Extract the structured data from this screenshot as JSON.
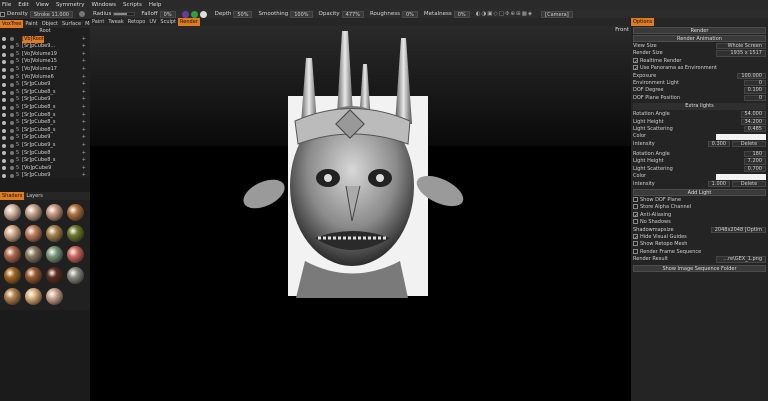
{
  "menubar": [
    "File",
    "Edit",
    "View",
    "Symmetry",
    "Windows",
    "Scripts",
    "Help"
  ],
  "toolbar": {
    "density_label": "Density",
    "density_value": "Stroke 11.000",
    "radius_label": "Radius",
    "radius_value": "65%",
    "falloff_label": "Falloff",
    "falloff_value": "0%",
    "depth_label": "Depth",
    "depth_value": "50%",
    "smoothing_label": "Smoothing",
    "smoothing_value": "100%",
    "opacity_label": "Opacity",
    "opacity_value": "477%",
    "roughness_label": "Roughness",
    "roughness_value": "0%",
    "metalness_label": "Metalness",
    "metalness_value": "0%",
    "camera_label": "[Camera]"
  },
  "left_tabs": [
    "VoxTree",
    "Paint",
    "Object",
    "Surface",
    "Mat"
  ],
  "tree": {
    "root": "Root",
    "items": [
      {
        "n": "",
        "label": "[Vb]Root",
        "sel": true
      },
      {
        "n": "5",
        "label": "[Sr]pCube9..."
      },
      {
        "n": "5",
        "label": "[Vo]Volume19"
      },
      {
        "n": "5",
        "label": "[Vo]Volume15"
      },
      {
        "n": "5",
        "label": "[Vo]Volume17"
      },
      {
        "n": "5",
        "label": "[Vo]Volume6"
      },
      {
        "n": "5",
        "label": "[Sr]pCube9"
      },
      {
        "n": "5",
        "label": "[Sr]pCube8_s"
      },
      {
        "n": "5",
        "label": "[Sr]pCube9"
      },
      {
        "n": "5",
        "label": "[Sr]pCube8_s"
      },
      {
        "n": "5",
        "label": "[Sr]pCube8_s"
      },
      {
        "n": "5",
        "label": "[Sr]pCube8_s"
      },
      {
        "n": "5",
        "label": "[Sr]pCube8_s"
      },
      {
        "n": "5",
        "label": "[Sr]pCube9"
      },
      {
        "n": "5",
        "label": "[Sr]pCube9_s"
      },
      {
        "n": "5",
        "label": "[Sr]pCube8"
      },
      {
        "n": "5",
        "label": "[Sr]pCube8_s"
      },
      {
        "n": "5",
        "label": "[Vo]pCube9"
      },
      {
        "n": "5",
        "label": "[Sr]pCube9"
      },
      {
        "n": "5",
        "label": "[Sr]pCube9"
      }
    ]
  },
  "shader_tabs": [
    "Shaders",
    "Layers"
  ],
  "shader_colors": [
    "#d8b7a0",
    "#c8a58c",
    "#c99a7e",
    "#b3723e",
    "#d4ac8c",
    "#c27f5c",
    "#a8844c",
    "#6f7a2c",
    "#b26a4a",
    "#8c7c5e",
    "#7b9a7b",
    "#d26a60",
    "#a06820",
    "#9a5a30",
    "#5a2e1c",
    "#8a8a80",
    "#b4824c",
    "#dcb07a",
    "#cba48a"
  ],
  "viewport_tabs": [
    "Paint",
    "Tweak",
    "Retopo",
    "UV",
    "Sculpt",
    "Render"
  ],
  "viewport_active": "Render",
  "viewport_label": "Front",
  "right_tabs": [
    "Options"
  ],
  "render": {
    "render_btn": "Render",
    "render_anim_btn": "Render Animation",
    "view_size_label": "View Size",
    "view_size_value": "Whole Screen",
    "render_size_label": "Render Size",
    "render_size_value": "1935 x 1517",
    "realtime_label": "Realtime Render",
    "panorama_label": "Use Panorama as Environment",
    "exposure_label": "Exposure",
    "exposure_value": "100.000",
    "env_light_label": "Environment Light",
    "env_light_value": "0",
    "dof_degree_label": "DOF Degree",
    "dof_degree_value": "0.100",
    "dof_plane_label": "DOF Plane Position",
    "dof_plane_value": "0",
    "extra_lights": "Extra lights",
    "l1_rot_label": "Rotation Angle",
    "l1_rot_value": "54.000",
    "l1_h_label": "Light Height",
    "l1_h_value": "34.200",
    "l1_sc_label": "Light Scattering",
    "l1_sc_value": "0.485",
    "l1_color_label": "Color",
    "l1_int_label": "Intensity",
    "l1_int_value": "0.300",
    "l1_del": "Delete",
    "l2_rot_label": "Rotation Angle",
    "l2_rot_value": "180",
    "l2_h_label": "Light Height",
    "l2_h_value": "7.200",
    "l2_sc_label": "Light Scattering",
    "l2_sc_value": "0.700",
    "l2_color_label": "Color",
    "l2_int_label": "Intensity",
    "l2_int_value": "1.000",
    "l2_del": "Delete",
    "add_light": "Add Light",
    "show_dof": "Show DOF Plane",
    "store_alpha": "Store Alpha Channel",
    "anti_alias": "Anti-Aliasing",
    "no_shadows": "No Shadows",
    "shadowmap_label": "Shadowmapsize",
    "shadowmap_value": "2048x2048 [Optim",
    "hide_guides": "Hide Visual Guides",
    "show_retopo": "Show Retopo Mesh",
    "frame_seq": "Render Frame Sequence",
    "result_label": "Render Result",
    "result_value": "...re\\GEX_1.png",
    "seq_folder_btn": "Show Image Sequence Folder"
  }
}
